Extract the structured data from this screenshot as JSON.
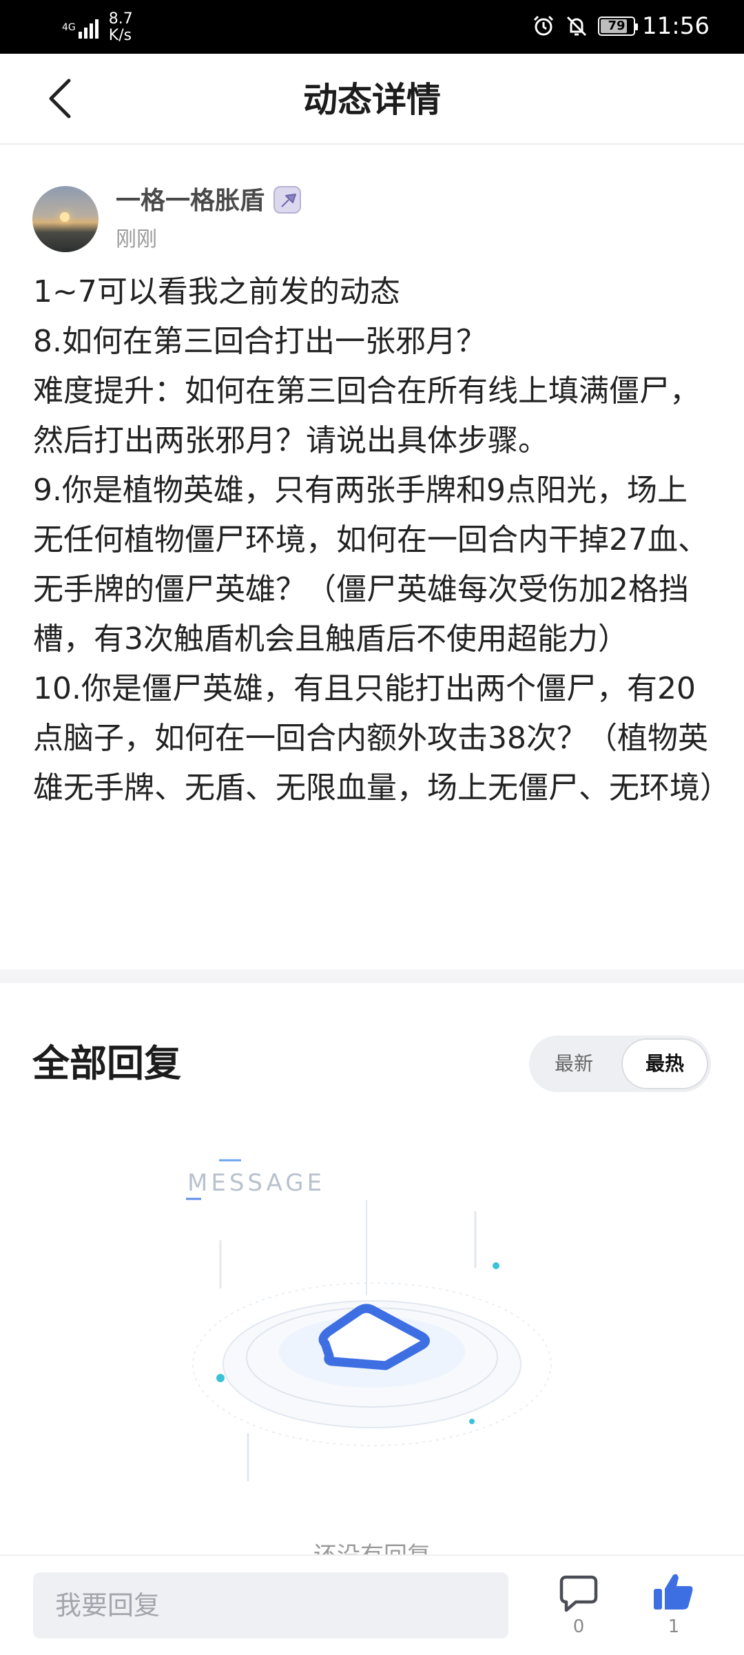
{
  "status_bar": {
    "network": "4G",
    "speed_value": "8.7",
    "speed_unit": "K/s",
    "battery": "79",
    "time": "11:56"
  },
  "nav": {
    "title": "动态详情"
  },
  "post": {
    "author": "一格一格胀盾",
    "time": "刚刚",
    "paragraphs": [
      "1~7可以看我之前发的动态",
      "8.如何在第三回合打出一张邪月？",
      "难度提升：如何在第三回合在所有线上填满僵尸，然后打出两张邪月？请说出具体步骤。",
      "9.你是植物英雄，只有两张手牌和9点阳光，场上无任何植物僵尸环境，如何在一回合内干掉27血、无手牌的僵尸英雄？（僵尸英雄每次受伤加2格挡槽，有3次触盾机会且触盾后不使用超能力）",
      "10.你是僵尸英雄，有且只能打出两个僵尸，有20点脑子，如何在一回合内额外攻击38次？（植物英雄无手牌、无盾、无限血量，场上无僵尸、无环境）"
    ]
  },
  "replies": {
    "title": "全部回复",
    "sort_options": [
      "最新",
      "最热"
    ],
    "selected_sort": "最热",
    "illustration_text": "MESSAGE",
    "empty_text": "还没有回复"
  },
  "bottom_bar": {
    "reply_placeholder": "我要回复",
    "comment_count": "0",
    "like_count": "1"
  },
  "colors": {
    "accent": "#3d6fe3",
    "status_bar_bg": "#000000",
    "divider": "#f4f4f6"
  }
}
